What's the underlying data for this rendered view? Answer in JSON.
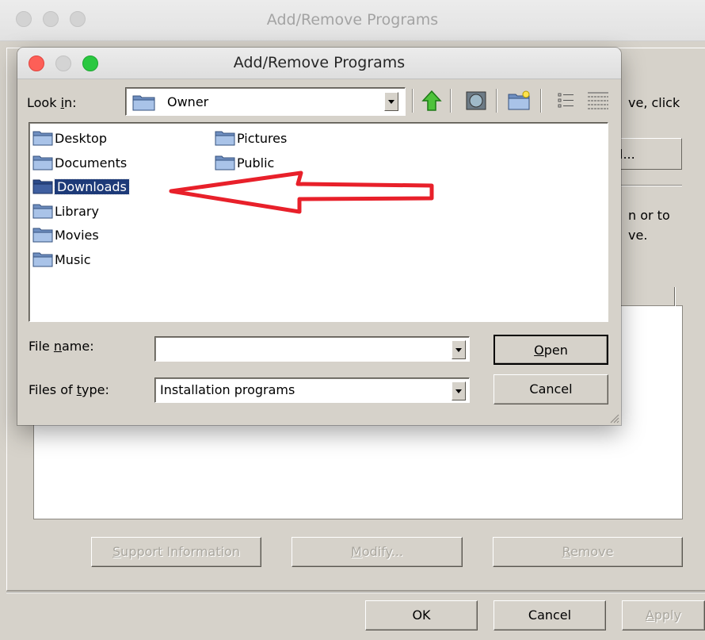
{
  "background_window": {
    "title": "Add/Remove Programs",
    "hint_line1": "ve, click",
    "browse_button_label": "l...",
    "hint_line2": "n or to",
    "hint_line3": "ve.",
    "buttons": {
      "support_pre": "",
      "support_u": "S",
      "support_post": "upport Information",
      "modify_u": "M",
      "modify_post": "odify...",
      "remove_u": "R",
      "remove_post": "emove",
      "ok": "OK",
      "cancel": "Cancel",
      "apply_u": "A",
      "apply_post": "pply"
    }
  },
  "dialog": {
    "title": "Add/Remove Programs",
    "look_in": {
      "label_pre": "Look ",
      "label_u": "i",
      "label_post": "n:",
      "value": "Owner"
    },
    "toolbar_icons": [
      "up-folder-icon",
      "desktop-icon",
      "new-folder-icon",
      "list-view-icon",
      "details-view-icon"
    ],
    "files": [
      {
        "name": "Desktop"
      },
      {
        "name": "Documents"
      },
      {
        "name": "Downloads",
        "selected": true
      },
      {
        "name": "Library"
      },
      {
        "name": "Movies"
      },
      {
        "name": "Music"
      },
      {
        "name": "Pictures"
      },
      {
        "name": "Public"
      }
    ],
    "file_name": {
      "label_pre": "File ",
      "label_u": "n",
      "label_post": "ame:",
      "value": ""
    },
    "files_of_type": {
      "label_pre": "Files of ",
      "label_u": "t",
      "label_post": "ype:",
      "value": "Installation programs"
    },
    "open_u": "O",
    "open_post": "pen",
    "cancel": "Cancel"
  },
  "colors": {
    "window_bg": "#d6d2ca",
    "selection": "#1d3a78",
    "annotation_arrow": "#e8202a",
    "close": "#fd5f57",
    "maximize": "#2ac840"
  }
}
